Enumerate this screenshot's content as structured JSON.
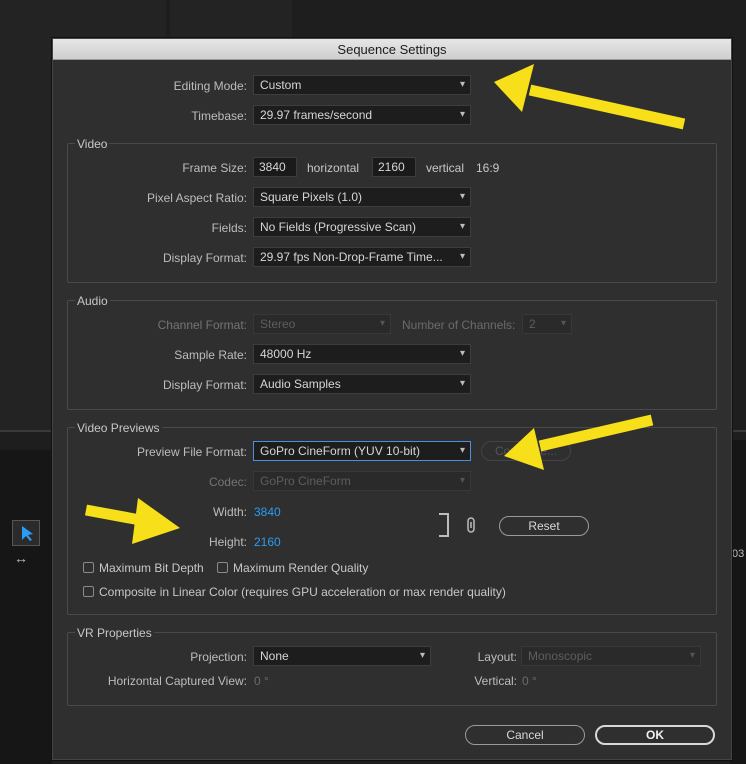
{
  "dialog": {
    "title": "Sequence Settings",
    "editing_mode": {
      "label": "Editing Mode:",
      "value": "Custom"
    },
    "timebase": {
      "label": "Timebase:",
      "value": "29.97  frames/second"
    }
  },
  "video": {
    "group_title": "Video",
    "frame_size": {
      "label": "Frame Size:",
      "width": "3840",
      "h_label": "horizontal",
      "height": "2160",
      "v_label": "vertical",
      "ratio": "16:9"
    },
    "pixel_aspect": {
      "label": "Pixel Aspect Ratio:",
      "value": "Square Pixels (1.0)"
    },
    "fields": {
      "label": "Fields:",
      "value": "No Fields (Progressive Scan)"
    },
    "display_format": {
      "label": "Display Format:",
      "value": "29.97 fps Non-Drop-Frame Time..."
    }
  },
  "audio": {
    "group_title": "Audio",
    "channel_format": {
      "label": "Channel Format:",
      "value": "Stereo"
    },
    "num_channels": {
      "label": "Number of Channels:",
      "value": "2"
    },
    "sample_rate": {
      "label": "Sample Rate:",
      "value": "48000 Hz"
    },
    "display_format": {
      "label": "Display Format:",
      "value": "Audio Samples"
    }
  },
  "previews": {
    "group_title": "Video Previews",
    "preview_format": {
      "label": "Preview File Format:",
      "value": "GoPro CineForm (YUV 10-bit)"
    },
    "configure_label": "Configure...",
    "codec": {
      "label": "Codec:",
      "value": "GoPro CineForm"
    },
    "width": {
      "label": "Width:",
      "value": "3840"
    },
    "height": {
      "label": "Height:",
      "value": "2160"
    },
    "reset_label": "Reset",
    "max_bit_depth": "Maximum Bit Depth",
    "max_render_quality": "Maximum Render Quality",
    "composite_linear": "Composite in Linear Color (requires GPU acceleration or max render quality)"
  },
  "vr": {
    "group_title": "VR Properties",
    "projection": {
      "label": "Projection:",
      "value": "None"
    },
    "layout": {
      "label": "Layout:",
      "value": "Monoscopic"
    },
    "h_view": {
      "label": "Horizontal Captured View:",
      "value": "0 °"
    },
    "vertical": {
      "label": "Vertical:",
      "value": "0 °"
    }
  },
  "buttons": {
    "cancel": "Cancel",
    "ok": "OK"
  },
  "background": {
    "timecode_fragment": "03"
  },
  "colors": {
    "accent_blue": "#2b9cf2",
    "arrow_yellow": "#f7e01a",
    "focus_border": "#4a8fe0"
  }
}
